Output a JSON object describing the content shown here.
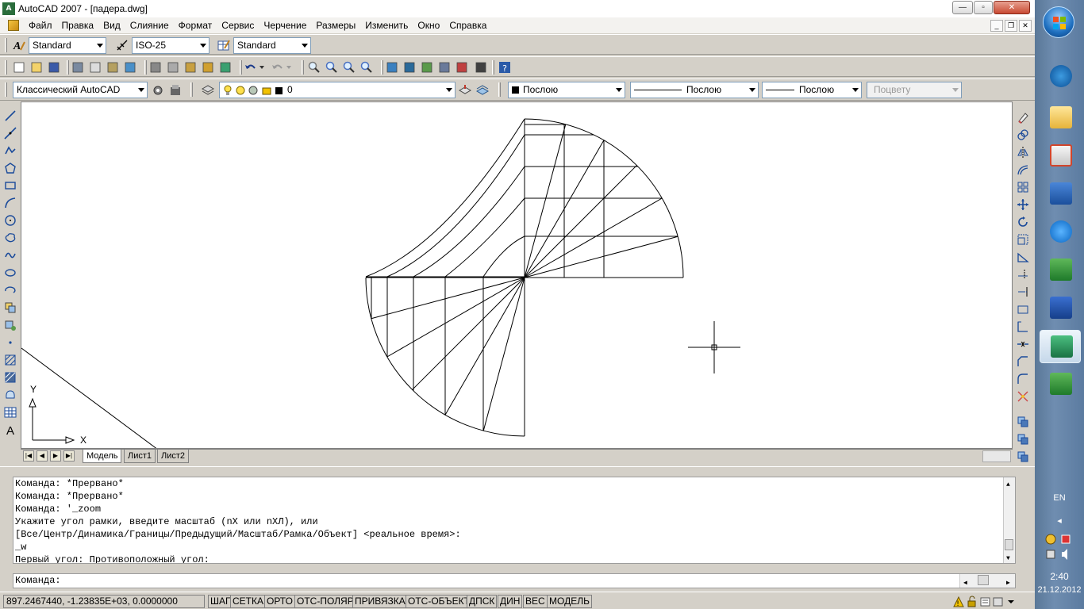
{
  "window": {
    "title": "AutoCAD 2007 - [падера.dwg]",
    "app_icon": "A",
    "controls": {
      "minimize": "—",
      "maximize": "▫",
      "close": "✕"
    },
    "doc_controls": {
      "minimize": "_",
      "restore": "❐",
      "close": "✕"
    }
  },
  "menu": [
    "Файл",
    "Правка",
    "Вид",
    "Слияние",
    "Формат",
    "Сервис",
    "Черчение",
    "Размеры",
    "Изменить",
    "Окно",
    "Справка"
  ],
  "styles_toolbar": {
    "text_style": "Standard",
    "dim_style": "ISO-25",
    "table_style": "Standard"
  },
  "workspace_toolbar": {
    "workspace": "Классический AutoCAD",
    "layer": "0",
    "color": "Послою",
    "linetype": "Послою",
    "lineweight": "Послою",
    "plotstyle": "Поцвету"
  },
  "layout_tabs": [
    "Модель",
    "Лист1",
    "Лист2"
  ],
  "active_tab": "Модель",
  "ucs": {
    "x_label": "X",
    "y_label": "Y"
  },
  "command_history": [
    "Команда: *Прервано*",
    "Команда: *Прервано*",
    "Команда: '_zoom",
    "Укажите угол рамки, введите масштаб (nX или nXЛ), или",
    "[Все/Центр/Динамика/Границы/Предыдущий/Масштаб/Рамка/Объект] <реальное время>:",
    "_w",
    "Первый угол: Противоположный угол:"
  ],
  "command_prompt": "Команда:",
  "status": {
    "coords": "897.2467440, -1.23835E+03, 0.0000000",
    "toggles": [
      "ШАГ",
      "СЕТКА",
      "ОРТО",
      "ОТС-ПОЛЯР",
      "ПРИВЯЗКА",
      "ОТС-ОБЪЕКТ",
      "ДПСК",
      "ДИН",
      "ВЕС",
      "МОДЕЛЬ"
    ]
  },
  "taskbar": {
    "lang": "EN",
    "time": "2:40",
    "date": "21.12.2012",
    "apps": [
      "hp-app",
      "folder-app",
      "presentation-app",
      "word-app",
      "mail-agent-app",
      "excel-app",
      "save-app",
      "autocad-app",
      "excel-app-2"
    ]
  },
  "colors": {
    "chrome": "#d4d0c8",
    "canvas": "#ffffff",
    "taskbar": "#6f8db0"
  }
}
